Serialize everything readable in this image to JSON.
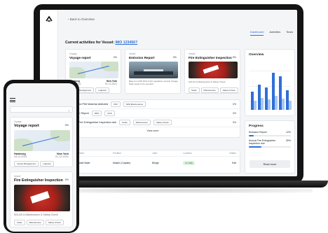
{
  "desktop": {
    "back_label": "Back to Overview",
    "tabs": [
      {
        "label": "Dashboard",
        "active": true
      },
      {
        "label": "Activities",
        "active": false
      },
      {
        "label": "Team",
        "active": false
      }
    ],
    "vessel_heading_prefix": "Current activities for Vessel:",
    "vessel_id": "IMO 123456?",
    "activity_cards": [
      {
        "label": "Voyage",
        "title": "Voyage report",
        "percent": "0%",
        "from": "Hamburg",
        "from_date": "24.11.2021",
        "to": "New York",
        "to_date": "01.12.2021",
        "chips": [
          "Vessel Management",
          "Logbook"
        ]
      },
      {
        "label": "Vessel",
        "title": "Emission Report",
        "percent": "0%",
        "description": "Based on IMO DCS & EU regulation vessels Voyage Data needs to be reported"
      },
      {
        "label": "Vessel",
        "title": "Fire Extinguisher Inspection",
        "percent": "0%",
        "description": "SOLAS & Maintenance & Safety Check",
        "chips": [
          "Solas",
          "Maintenance",
          "Safety Check"
        ]
      }
    ],
    "activity_rows": [
      {
        "title": "Combined PMI Material detected",
        "chips": [
          "PMI",
          "SRN Maintenance"
        ],
        "percent": "0%"
      },
      {
        "title": "Emission Report",
        "chips": [
          "MRV",
          "DCS"
        ],
        "percent": "0%"
      },
      {
        "title": "Annual Fire Extinguisher Inspection due",
        "chips": [
          "Solas",
          "Maintenance",
          "Safety Check"
        ],
        "percent": "0%"
      }
    ],
    "view_more_label": "View more",
    "members_title": "Members",
    "members_columns": [
      "Crew Member",
      "Position",
      "Joint",
      "Location",
      "Status"
    ],
    "members_rows": [
      {
        "name": "Schmidt Maier",
        "position": "Master (Captain)",
        "joint": "",
        "location": "Bridge",
        "status": "on duty",
        "action": "Edit"
      }
    ],
    "overview_title": "Overview",
    "overview_chart": {
      "type": "bar",
      "series": [
        {
          "color": "#2f6fd8",
          "values": [
            0.45,
            0.62,
            0.55,
            0.92,
            0.82,
            0.48
          ]
        },
        {
          "color": "#a9c8f5",
          "values": [
            0.22,
            0.3,
            0.26,
            0.34,
            0.28,
            0.22
          ]
        }
      ]
    },
    "progress_title": "Progress",
    "progress_items": [
      {
        "label": "Emission Report",
        "value": "12%",
        "fraction": 0.12
      },
      {
        "label": "Annual Fire Extinguisher Inspection due",
        "value": "30%",
        "fraction": 0.3
      }
    ],
    "read_more_label": "Read more"
  },
  "mobile": {
    "cards": [
      {
        "label": "Voyage",
        "title": "Voyage report",
        "percent": "0%",
        "from": "Hamburg",
        "from_date": "24.11.2021",
        "to": "New York",
        "to_date": "01.12.2021",
        "chips": [
          "Vessel Management",
          "Logbook"
        ]
      },
      {
        "label": "Vessel",
        "title": "Fire Extinguisher Inspection",
        "percent": "0%",
        "description": "SOLAS & Maintenance & Safety Check",
        "chips": [
          "Solas",
          "Maintenance",
          "Safety Check"
        ]
      }
    ]
  }
}
